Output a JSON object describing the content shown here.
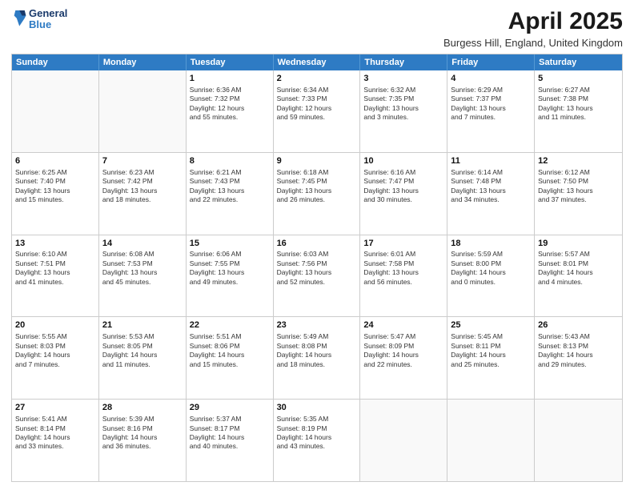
{
  "header": {
    "logo_line1": "General",
    "logo_line2": "Blue",
    "title": "April 2025",
    "subtitle": "Burgess Hill, England, United Kingdom"
  },
  "calendar": {
    "days": [
      "Sunday",
      "Monday",
      "Tuesday",
      "Wednesday",
      "Thursday",
      "Friday",
      "Saturday"
    ],
    "rows": [
      [
        {
          "day": "",
          "empty": true
        },
        {
          "day": "",
          "empty": true
        },
        {
          "day": "1",
          "lines": [
            "Sunrise: 6:36 AM",
            "Sunset: 7:32 PM",
            "Daylight: 12 hours",
            "and 55 minutes."
          ]
        },
        {
          "day": "2",
          "lines": [
            "Sunrise: 6:34 AM",
            "Sunset: 7:33 PM",
            "Daylight: 12 hours",
            "and 59 minutes."
          ]
        },
        {
          "day": "3",
          "lines": [
            "Sunrise: 6:32 AM",
            "Sunset: 7:35 PM",
            "Daylight: 13 hours",
            "and 3 minutes."
          ]
        },
        {
          "day": "4",
          "lines": [
            "Sunrise: 6:29 AM",
            "Sunset: 7:37 PM",
            "Daylight: 13 hours",
            "and 7 minutes."
          ]
        },
        {
          "day": "5",
          "lines": [
            "Sunrise: 6:27 AM",
            "Sunset: 7:38 PM",
            "Daylight: 13 hours",
            "and 11 minutes."
          ]
        }
      ],
      [
        {
          "day": "6",
          "lines": [
            "Sunrise: 6:25 AM",
            "Sunset: 7:40 PM",
            "Daylight: 13 hours",
            "and 15 minutes."
          ]
        },
        {
          "day": "7",
          "lines": [
            "Sunrise: 6:23 AM",
            "Sunset: 7:42 PM",
            "Daylight: 13 hours",
            "and 18 minutes."
          ]
        },
        {
          "day": "8",
          "lines": [
            "Sunrise: 6:21 AM",
            "Sunset: 7:43 PM",
            "Daylight: 13 hours",
            "and 22 minutes."
          ]
        },
        {
          "day": "9",
          "lines": [
            "Sunrise: 6:18 AM",
            "Sunset: 7:45 PM",
            "Daylight: 13 hours",
            "and 26 minutes."
          ]
        },
        {
          "day": "10",
          "lines": [
            "Sunrise: 6:16 AM",
            "Sunset: 7:47 PM",
            "Daylight: 13 hours",
            "and 30 minutes."
          ]
        },
        {
          "day": "11",
          "lines": [
            "Sunrise: 6:14 AM",
            "Sunset: 7:48 PM",
            "Daylight: 13 hours",
            "and 34 minutes."
          ]
        },
        {
          "day": "12",
          "lines": [
            "Sunrise: 6:12 AM",
            "Sunset: 7:50 PM",
            "Daylight: 13 hours",
            "and 37 minutes."
          ]
        }
      ],
      [
        {
          "day": "13",
          "lines": [
            "Sunrise: 6:10 AM",
            "Sunset: 7:51 PM",
            "Daylight: 13 hours",
            "and 41 minutes."
          ]
        },
        {
          "day": "14",
          "lines": [
            "Sunrise: 6:08 AM",
            "Sunset: 7:53 PM",
            "Daylight: 13 hours",
            "and 45 minutes."
          ]
        },
        {
          "day": "15",
          "lines": [
            "Sunrise: 6:06 AM",
            "Sunset: 7:55 PM",
            "Daylight: 13 hours",
            "and 49 minutes."
          ]
        },
        {
          "day": "16",
          "lines": [
            "Sunrise: 6:03 AM",
            "Sunset: 7:56 PM",
            "Daylight: 13 hours",
            "and 52 minutes."
          ]
        },
        {
          "day": "17",
          "lines": [
            "Sunrise: 6:01 AM",
            "Sunset: 7:58 PM",
            "Daylight: 13 hours",
            "and 56 minutes."
          ]
        },
        {
          "day": "18",
          "lines": [
            "Sunrise: 5:59 AM",
            "Sunset: 8:00 PM",
            "Daylight: 14 hours",
            "and 0 minutes."
          ]
        },
        {
          "day": "19",
          "lines": [
            "Sunrise: 5:57 AM",
            "Sunset: 8:01 PM",
            "Daylight: 14 hours",
            "and 4 minutes."
          ]
        }
      ],
      [
        {
          "day": "20",
          "lines": [
            "Sunrise: 5:55 AM",
            "Sunset: 8:03 PM",
            "Daylight: 14 hours",
            "and 7 minutes."
          ]
        },
        {
          "day": "21",
          "lines": [
            "Sunrise: 5:53 AM",
            "Sunset: 8:05 PM",
            "Daylight: 14 hours",
            "and 11 minutes."
          ]
        },
        {
          "day": "22",
          "lines": [
            "Sunrise: 5:51 AM",
            "Sunset: 8:06 PM",
            "Daylight: 14 hours",
            "and 15 minutes."
          ]
        },
        {
          "day": "23",
          "lines": [
            "Sunrise: 5:49 AM",
            "Sunset: 8:08 PM",
            "Daylight: 14 hours",
            "and 18 minutes."
          ]
        },
        {
          "day": "24",
          "lines": [
            "Sunrise: 5:47 AM",
            "Sunset: 8:09 PM",
            "Daylight: 14 hours",
            "and 22 minutes."
          ]
        },
        {
          "day": "25",
          "lines": [
            "Sunrise: 5:45 AM",
            "Sunset: 8:11 PM",
            "Daylight: 14 hours",
            "and 25 minutes."
          ]
        },
        {
          "day": "26",
          "lines": [
            "Sunrise: 5:43 AM",
            "Sunset: 8:13 PM",
            "Daylight: 14 hours",
            "and 29 minutes."
          ]
        }
      ],
      [
        {
          "day": "27",
          "lines": [
            "Sunrise: 5:41 AM",
            "Sunset: 8:14 PM",
            "Daylight: 14 hours",
            "and 33 minutes."
          ]
        },
        {
          "day": "28",
          "lines": [
            "Sunrise: 5:39 AM",
            "Sunset: 8:16 PM",
            "Daylight: 14 hours",
            "and 36 minutes."
          ]
        },
        {
          "day": "29",
          "lines": [
            "Sunrise: 5:37 AM",
            "Sunset: 8:17 PM",
            "Daylight: 14 hours",
            "and 40 minutes."
          ]
        },
        {
          "day": "30",
          "lines": [
            "Sunrise: 5:35 AM",
            "Sunset: 8:19 PM",
            "Daylight: 14 hours",
            "and 43 minutes."
          ]
        },
        {
          "day": "",
          "empty": true
        },
        {
          "day": "",
          "empty": true
        },
        {
          "day": "",
          "empty": true
        }
      ]
    ]
  }
}
